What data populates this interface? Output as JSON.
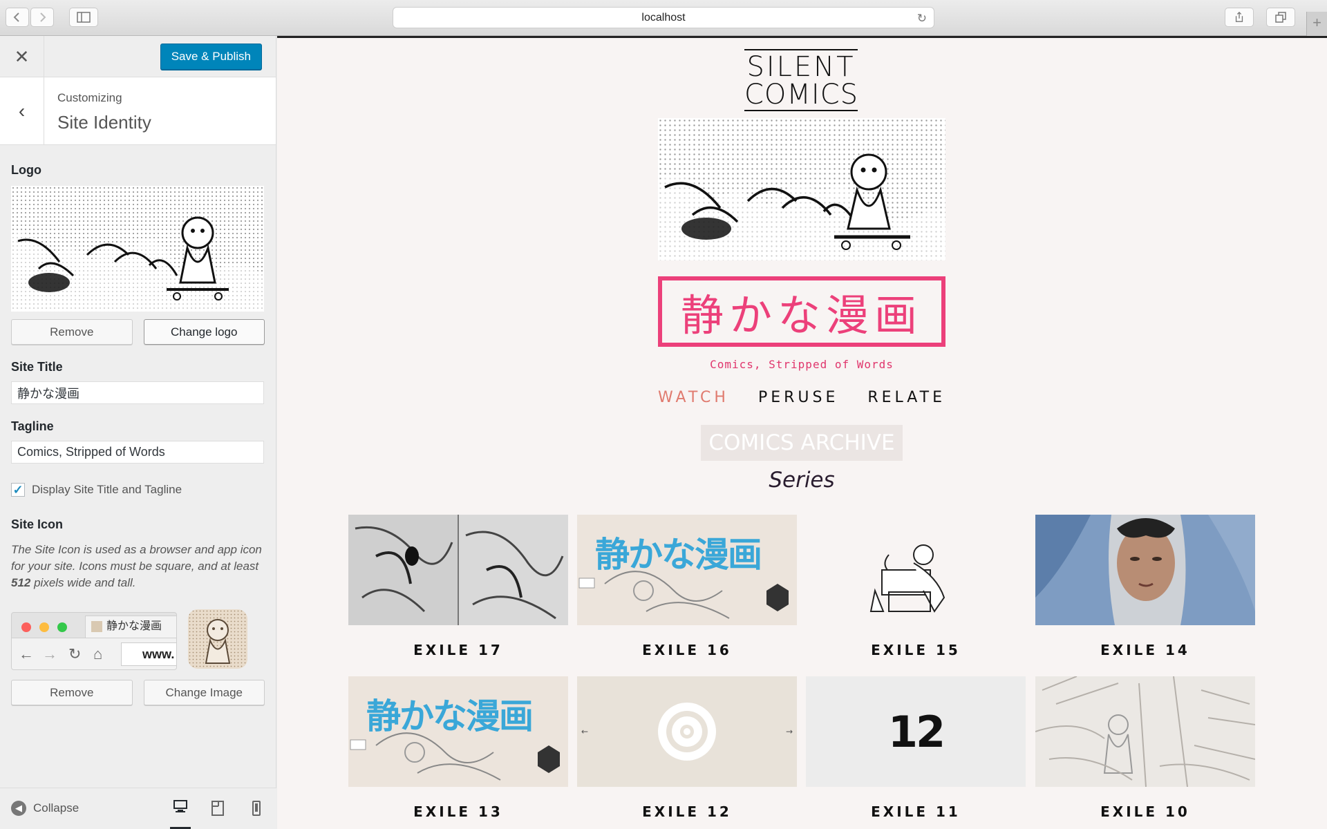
{
  "browser": {
    "url": "localhost"
  },
  "customizer": {
    "publish_label": "Save & Publish",
    "crumb": "Customizing",
    "section_title": "Site Identity",
    "logo_label": "Logo",
    "logo_remove": "Remove",
    "logo_change": "Change logo",
    "site_title_label": "Site Title",
    "site_title_value": "静かな漫画",
    "tagline_label": "Tagline",
    "tagline_value": "Comics, Stripped of Words",
    "display_toggle_label": "Display Site Title and Tagline",
    "display_toggle_checked": true,
    "site_icon_label": "Site Icon",
    "site_icon_desc_pre": "The Site Icon is used as a browser and app icon for your site. Icons must be square, and at least ",
    "site_icon_desc_num": "512",
    "site_icon_desc_post": " pixels wide and tall.",
    "mini_tab_title": "静かな漫画",
    "mini_url": "www.",
    "icon_remove": "Remove",
    "icon_change": "Change Image",
    "collapse_label": "Collapse"
  },
  "site": {
    "brand_line1": "SILENT",
    "brand_line2": "COMICS",
    "title": "静かな漫画",
    "tagline": "Comics, Stripped of Words",
    "nav": [
      {
        "label": "WATCH",
        "active": true
      },
      {
        "label": "PERUSE",
        "active": false
      },
      {
        "label": "RELATE",
        "active": false
      }
    ],
    "archive_heading": "COMICS ARCHIVE",
    "series_heading": "Series",
    "comics": [
      {
        "title": "EXILE 17",
        "art": "sketch"
      },
      {
        "title": "EXILE 16",
        "art": "blue-title"
      },
      {
        "title": "EXILE 15",
        "art": "figure"
      },
      {
        "title": "EXILE 14",
        "art": "portrait"
      },
      {
        "title": "EXILE 13",
        "art": "blue-title"
      },
      {
        "title": "EXILE 12",
        "art": "target"
      },
      {
        "title": "EXILE 11",
        "art": "number",
        "number_text": "12"
      },
      {
        "title": "EXILE 10",
        "art": "pencil"
      }
    ],
    "thumb_title_text": "静かな漫画"
  },
  "colors": {
    "accent_pink": "#ec407a",
    "wp_blue": "#0085ba",
    "nav_active": "#e07a6e",
    "thumb_blue": "#3aa7d8"
  }
}
